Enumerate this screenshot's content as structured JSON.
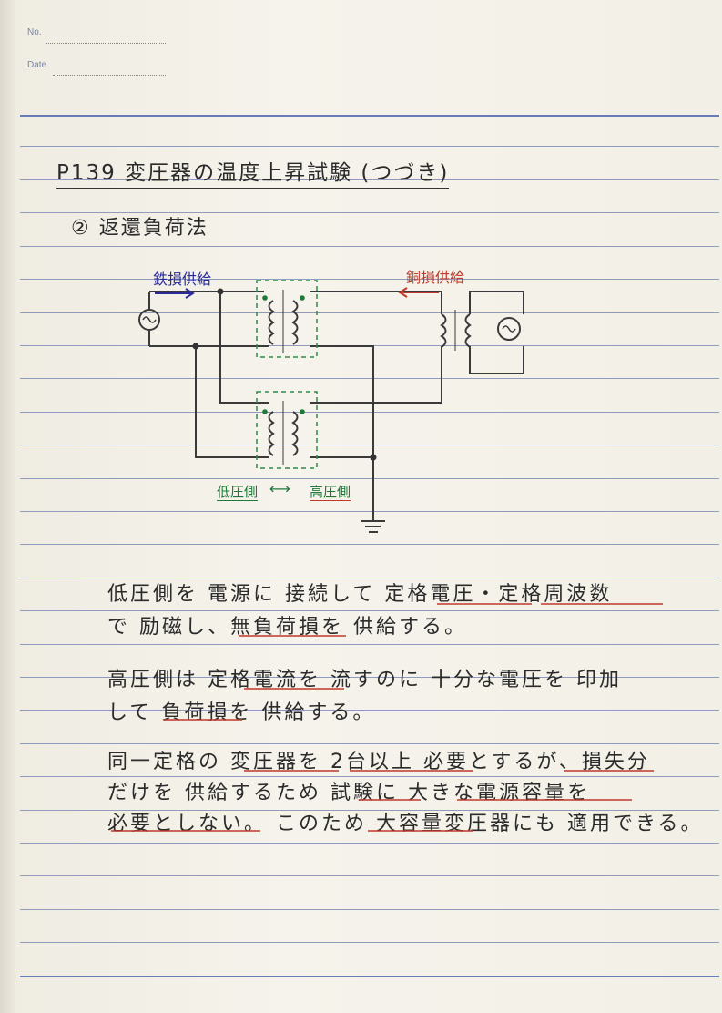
{
  "header": {
    "no_label": "No.",
    "date_label": "Date"
  },
  "title": "P139 変圧器の温度上昇試験 (つづき)",
  "subtitle": "② 返還負荷法",
  "diagram": {
    "label_iron_loss": "鉄損供給",
    "label_copper_loss": "銅損供給",
    "label_low_side": "低圧側",
    "label_arrow": "⟷",
    "label_high_side": "高圧側",
    "colors": {
      "wire": "#3a3a3a",
      "core": "#2f8a4a",
      "dot": "#1f7a3a",
      "iron_arrow": "#2a2a9a",
      "copper_arrow": "#c0392b"
    }
  },
  "paragraphs": [
    {
      "lines": [
        "低圧側を 電源に 接続して 定格電圧・定格周波数",
        "で 励磁し、無負荷損を 供給する。"
      ]
    },
    {
      "lines": [
        "高圧側は 定格電流を 流すのに 十分な電圧を 印加",
        "して 負荷損を 供給する。"
      ]
    },
    {
      "lines": [
        "同一定格の 変圧器を 2台以上 必要とするが、損失分",
        "だけを 供給するため 試験に 大きな電源容量を",
        "必要としない。 このため 大容量変圧器にも 適用できる。"
      ]
    }
  ]
}
